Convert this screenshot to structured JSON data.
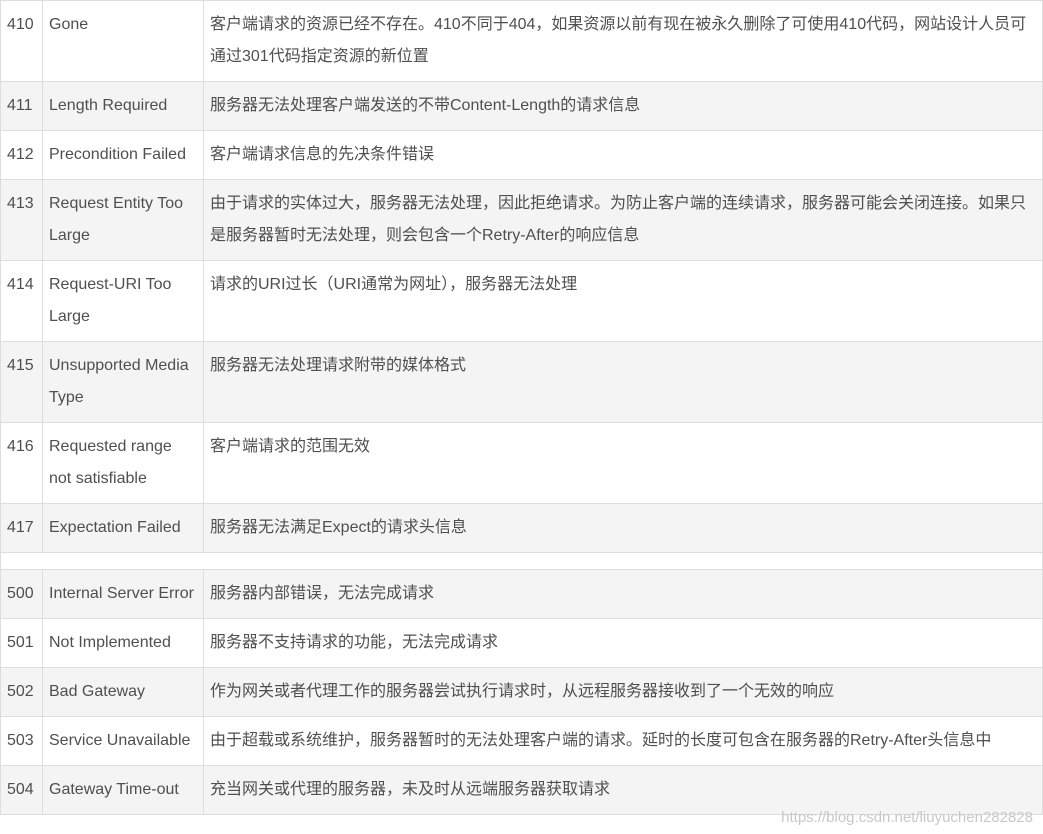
{
  "table": {
    "rows_4xx": [
      {
        "code": "410",
        "name": "Gone",
        "desc": "客户端请求的资源已经不存在。410不同于404，如果资源以前有现在被永久删除了可使用410代码，网站设计人员可通过301代码指定资源的新位置"
      },
      {
        "code": "411",
        "name": "Length Required",
        "desc": "服务器无法处理客户端发送的不带Content-Length的请求信息"
      },
      {
        "code": "412",
        "name": "Precondition Failed",
        "desc": "客户端请求信息的先决条件错误"
      },
      {
        "code": "413",
        "name": "Request Entity Too Large",
        "desc": "由于请求的实体过大，服务器无法处理，因此拒绝请求。为防止客户端的连续请求，服务器可能会关闭连接。如果只是服务器暂时无法处理，则会包含一个Retry-After的响应信息"
      },
      {
        "code": "414",
        "name": "Request-URI Too Large",
        "desc": "请求的URI过长（URI通常为网址），服务器无法处理"
      },
      {
        "code": "415",
        "name": "Unsupported Media Type",
        "desc": "服务器无法处理请求附带的媒体格式"
      },
      {
        "code": "416",
        "name": "Requested range not satisfiable",
        "desc": "客户端请求的范围无效"
      },
      {
        "code": "417",
        "name": "Expectation Failed",
        "desc": "服务器无法满足Expect的请求头信息"
      }
    ],
    "rows_5xx": [
      {
        "code": "500",
        "name": "Internal Server Error",
        "desc": "服务器内部错误，无法完成请求"
      },
      {
        "code": "501",
        "name": "Not Implemented",
        "desc": "服务器不支持请求的功能，无法完成请求"
      },
      {
        "code": "502",
        "name": "Bad Gateway",
        "desc": "作为网关或者代理工作的服务器尝试执行请求时，从远程服务器接收到了一个无效的响应"
      },
      {
        "code": "503",
        "name": "Service Unavailable",
        "desc": "由于超载或系统维护，服务器暂时的无法处理客户端的请求。延时的长度可包含在服务器的Retry-After头信息中"
      },
      {
        "code": "504",
        "name": "Gateway Time-out",
        "desc": "充当网关或代理的服务器，未及时从远端服务器获取请求"
      }
    ]
  },
  "watermark": "https://blog.csdn.net/liuyuchen282828"
}
